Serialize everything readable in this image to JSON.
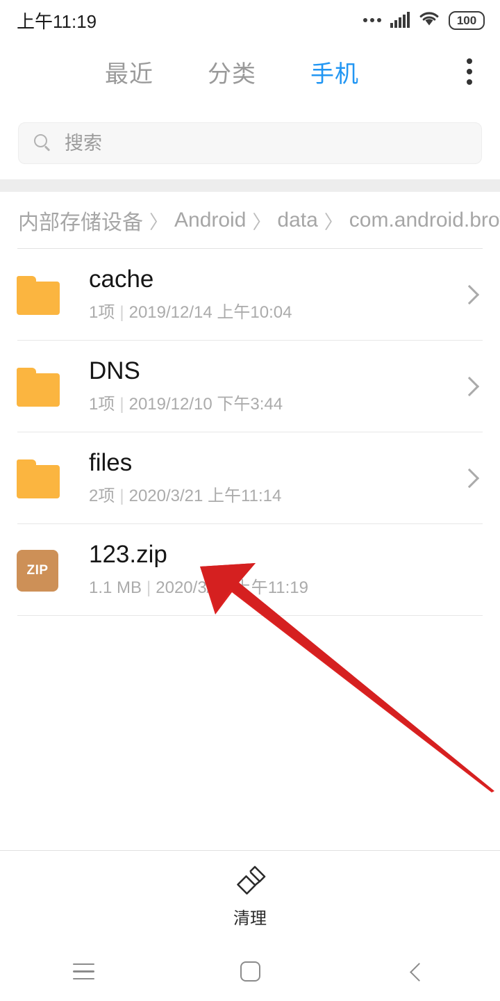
{
  "status_bar": {
    "time": "上午11:19",
    "battery_level": "100",
    "icons": [
      "more-dots-icon",
      "signal-icon",
      "wifi-icon",
      "battery-icon"
    ]
  },
  "header": {
    "tabs": [
      {
        "label": "最近",
        "active": false
      },
      {
        "label": "分类",
        "active": false
      },
      {
        "label": "手机",
        "active": true
      }
    ],
    "overflow_menu_label": "更多",
    "active_color": "#2196f3",
    "inactive_color": "#9a9a9a"
  },
  "search": {
    "placeholder": "搜索",
    "value": ""
  },
  "breadcrumb": {
    "separator": "〉",
    "items": [
      "内部存储设备",
      "Android",
      "data",
      "com.android.browse"
    ]
  },
  "file_list": [
    {
      "name": "cache",
      "type": "folder",
      "icon": "folder-icon",
      "count": "1项",
      "separator": "|",
      "date": "2019/12/14 上午10:04",
      "has_chevron": true
    },
    {
      "name": "DNS",
      "type": "folder",
      "icon": "folder-icon",
      "count": "1项",
      "separator": "|",
      "date": "2019/12/10 下午3:44",
      "has_chevron": true
    },
    {
      "name": "files",
      "type": "folder",
      "icon": "folder-icon",
      "count": "2项",
      "separator": "|",
      "date": "2020/3/21 上午11:14",
      "has_chevron": true
    },
    {
      "name": "123.zip",
      "type": "zip",
      "icon": "zip-file-icon",
      "icon_label": "ZIP",
      "count": "1.1 MB",
      "separator": "|",
      "date": "2020/3/21 上午11:19",
      "has_chevron": false
    }
  ],
  "annotation": {
    "type": "arrow",
    "color": "#dd2222",
    "points_at": "123.zip"
  },
  "bottom_toolbar": {
    "clean_label": "清理",
    "clean_icon": "broom-icon"
  },
  "nav_bar": {
    "recents_label": "最近任务",
    "home_label": "主页",
    "back_label": "返回"
  },
  "colors": {
    "accent": "#2196f3",
    "folder": "#fbb540",
    "zip": "#cd9057",
    "annotation_red": "#dd2222",
    "band_gray": "#ededed"
  }
}
